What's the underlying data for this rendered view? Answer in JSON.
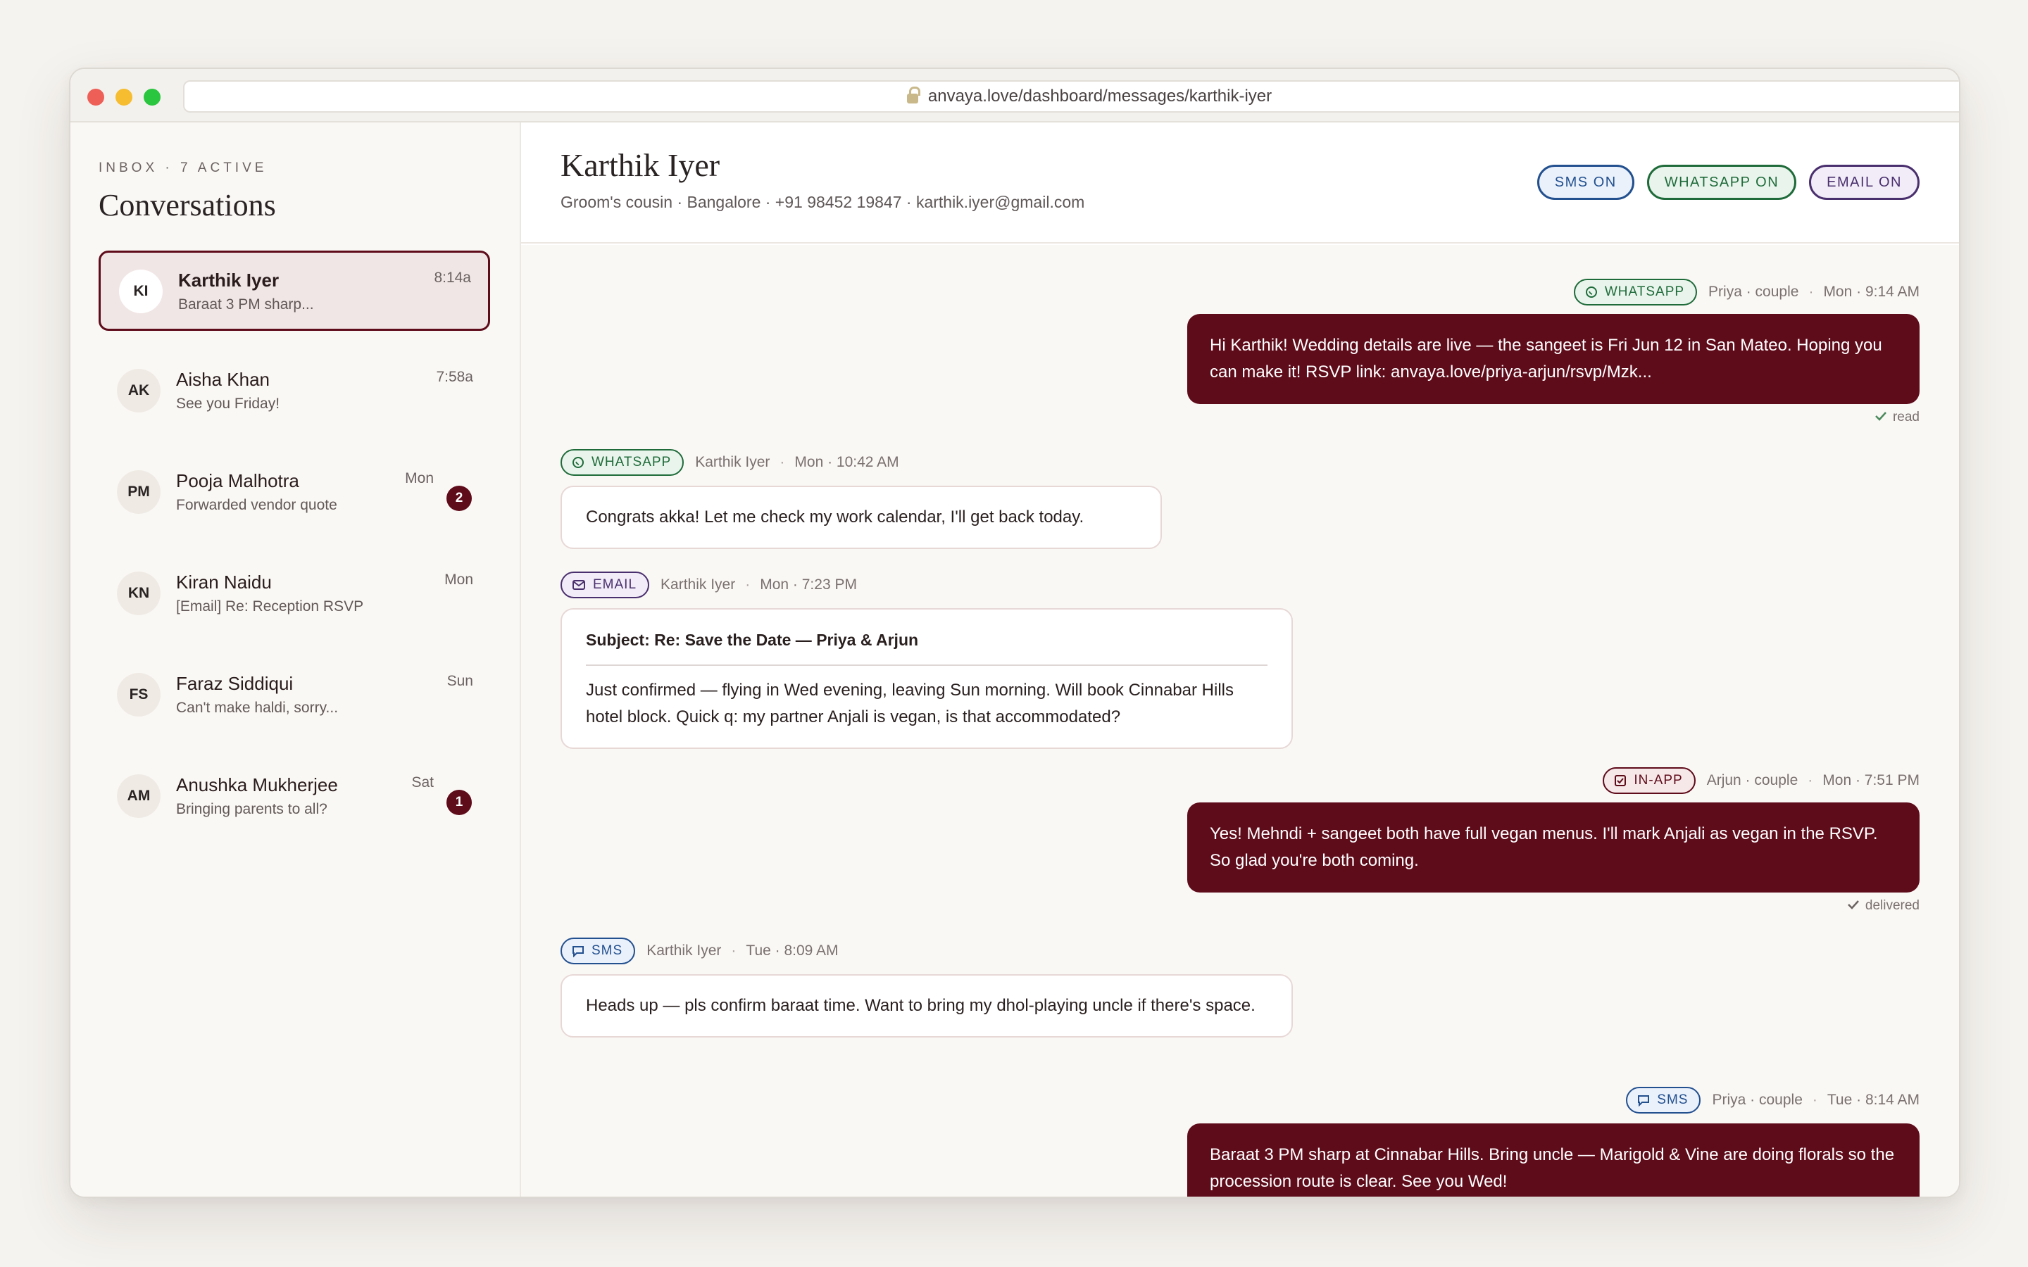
{
  "browser": {
    "url": "anvaya.love/dashboard/messages/karthik-iyer"
  },
  "sidebar": {
    "kicker": "INBOX · 7 ACTIVE",
    "title": "Conversations",
    "items": [
      {
        "initials": "KI",
        "name": "Karthik Iyer",
        "preview": "Baraat 3 PM sharp...",
        "time": "8:14a"
      },
      {
        "initials": "AK",
        "name": "Aisha Khan",
        "preview": "See you Friday!",
        "time": "7:58a"
      },
      {
        "initials": "PM",
        "name": "Pooja Malhotra",
        "preview": "Forwarded vendor quote",
        "time": "Mon",
        "unread": "2"
      },
      {
        "initials": "KN",
        "name": "Kiran Naidu",
        "preview": "[Email] Re: Reception RSVP",
        "time": "Mon"
      },
      {
        "initials": "FS",
        "name": "Faraz Siddiqui",
        "preview": "Can't make haldi, sorry...",
        "time": "Sun"
      },
      {
        "initials": "AM",
        "name": "Anushka Mukherjee",
        "preview": "Bringing parents to all?",
        "time": "Sat",
        "unread": "1"
      }
    ]
  },
  "header": {
    "name": "Karthik Iyer",
    "meta": "Groom's cousin · Bangalore · +91 98452 19847 · karthik.iyer@gmail.com",
    "toggles": {
      "sms": "SMS ON",
      "whatsapp": "WHATSAPP ON",
      "email": "EMAIL ON"
    }
  },
  "messages": [
    {
      "channel": "WHATSAPP",
      "who": "Priya · couple",
      "time": "Mon · 9:14 AM",
      "text": "Hi Karthik! Wedding details are live — the sangeet is Fri Jun 12 in San Mateo. Hoping you can make it! RSVP link: anvaya.love/priya-arjun/rsvp/Mzk...",
      "status": "read"
    },
    {
      "channel": "WHATSAPP",
      "who": "Karthik Iyer",
      "time": "Mon · 10:42 AM",
      "text": "Congrats akka! Let me check my work calendar, I'll get back today."
    },
    {
      "channel": "EMAIL",
      "who": "Karthik Iyer",
      "time": "Mon · 7:23 PM",
      "subject": "Subject: Re: Save the Date — Priya & Arjun",
      "text": "Just confirmed — flying in Wed evening, leaving Sun morning. Will book Cinnabar Hills hotel block. Quick q: my partner Anjali is vegan, is that accommodated?"
    },
    {
      "channel": "IN-APP",
      "who": "Arjun · couple",
      "time": "Mon · 7:51 PM",
      "text": "Yes! Mehndi + sangeet both have full vegan menus. I'll mark Anjali as vegan in the RSVP. So glad you're both coming.",
      "status": "delivered"
    },
    {
      "channel": "SMS",
      "who": "Karthik Iyer",
      "time": "Tue · 8:09 AM",
      "text": "Heads up — pls confirm baraat time. Want to bring my dhol-playing uncle if there's space."
    },
    {
      "channel": "SMS",
      "who": "Priya · couple",
      "time": "Tue · 8:14 AM",
      "text": "Baraat 3 PM sharp at Cinnabar Hills. Bring uncle — Marigold & Vine are doing florals so the procession route is clear. See you Wed!"
    }
  ]
}
